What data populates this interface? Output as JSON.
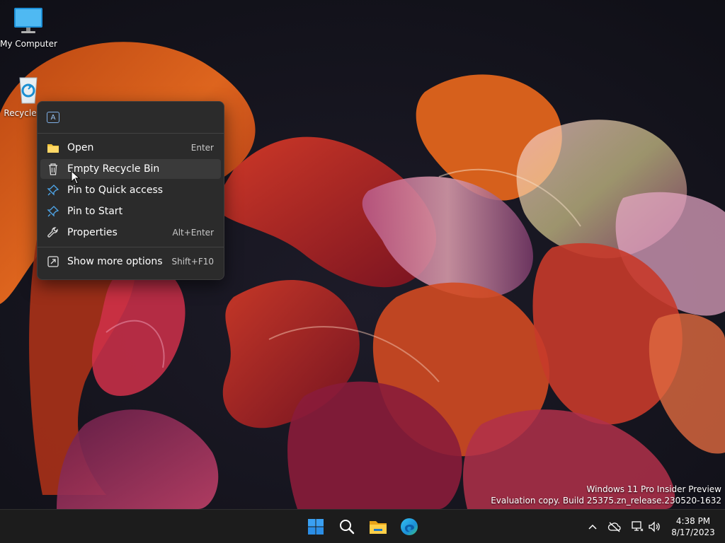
{
  "desktop": {
    "icons": [
      {
        "label": "My Computer",
        "icon": "monitor-icon"
      },
      {
        "label": "Recycle Bin",
        "icon": "recycle-bin-icon"
      }
    ]
  },
  "context_menu": {
    "top_action_icon": "ai-chip-icon",
    "items": [
      {
        "label": "Open",
        "shortcut": "Enter",
        "icon": "folder-icon"
      },
      {
        "label": "Empty Recycle Bin",
        "shortcut": "",
        "icon": "trash-icon",
        "hovered": true
      },
      {
        "label": "Pin to Quick access",
        "shortcut": "",
        "icon": "pin-icon"
      },
      {
        "label": "Pin to Start",
        "shortcut": "",
        "icon": "pin-icon"
      },
      {
        "label": "Properties",
        "shortcut": "Alt+Enter",
        "icon": "wrench-icon"
      },
      {
        "label": "Show more options",
        "shortcut": "Shift+F10",
        "icon": "expand-icon"
      }
    ]
  },
  "watermark": {
    "line1": "Windows 11 Pro Insider Preview",
    "line2": "Evaluation copy. Build 25375.zn_release.230520-1632"
  },
  "taskbar": {
    "apps": [
      {
        "name": "Start",
        "icon": "windows-logo-icon"
      },
      {
        "name": "Search",
        "icon": "search-icon"
      },
      {
        "name": "File Explorer",
        "icon": "folder-icon"
      },
      {
        "name": "Microsoft Edge",
        "icon": "edge-icon"
      }
    ],
    "tray": {
      "icons": [
        "chevron-up-icon",
        "cloud-offline-icon",
        "network-icon",
        "volume-icon"
      ],
      "time": "4:38 PM",
      "date": "8/17/2023"
    }
  },
  "colors": {
    "menu_bg": "#2b2b2b",
    "menu_hover": "#3a3a3a",
    "taskbar_bg": "#1c1c1c",
    "accent": "#0078d4"
  }
}
